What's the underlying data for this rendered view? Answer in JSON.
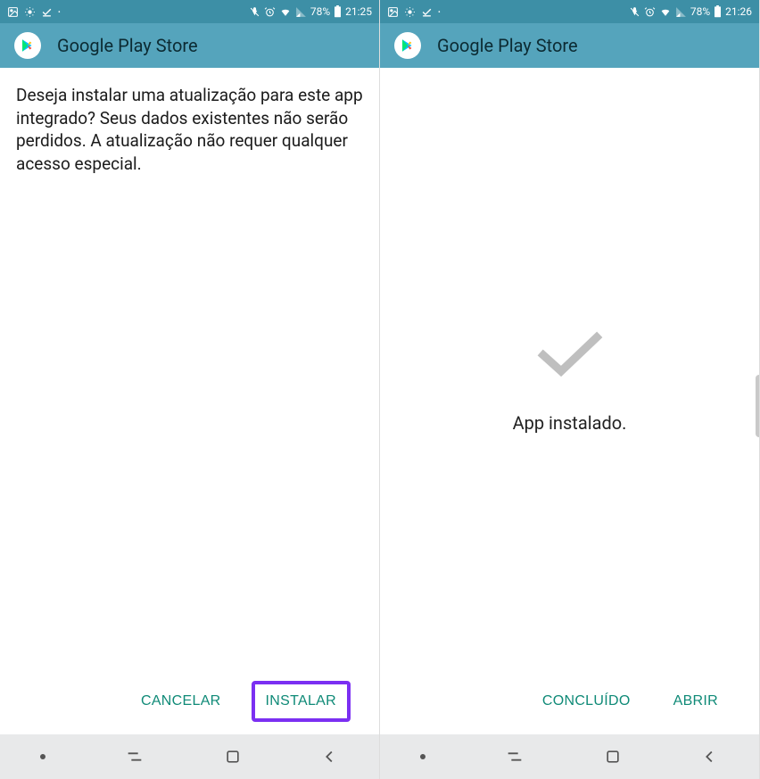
{
  "left": {
    "status": {
      "battery_pct": "78%",
      "time": "21:25"
    },
    "title": "Google Play Store",
    "message": "Deseja instalar uma atualização para este app integrado? Seus dados existentes não serão perdidos. A atualização não requer qualquer acesso especial.",
    "actions": {
      "cancel": "CANCELAR",
      "install": "INSTALAR"
    }
  },
  "right": {
    "status": {
      "battery_pct": "78%",
      "time": "21:26"
    },
    "title": "Google Play Store",
    "installed_text": "App instalado.",
    "actions": {
      "done": "CONCLUÍDO",
      "open": "ABRIR"
    }
  }
}
